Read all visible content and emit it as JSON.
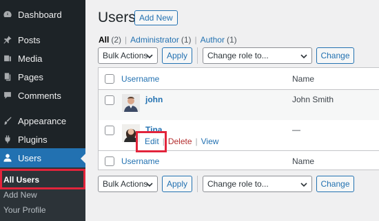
{
  "sidebar": {
    "items": [
      {
        "label": "Dashboard",
        "icon": "dashboard-icon"
      },
      {
        "label": "Posts",
        "icon": "pin-icon"
      },
      {
        "label": "Media",
        "icon": "media-icon"
      },
      {
        "label": "Pages",
        "icon": "pages-icon"
      },
      {
        "label": "Comments",
        "icon": "comment-icon"
      },
      {
        "label": "Appearance",
        "icon": "brush-icon"
      },
      {
        "label": "Plugins",
        "icon": "plugin-icon"
      },
      {
        "label": "Users",
        "icon": "user-icon"
      }
    ],
    "submenu": [
      {
        "label": "All Users"
      },
      {
        "label": "Add New"
      },
      {
        "label": "Your Profile"
      }
    ]
  },
  "main": {
    "title": "Users",
    "add_new": "Add New",
    "views": [
      {
        "label": "All",
        "count": "(2)"
      },
      {
        "label": "Administrator",
        "count": "(1)"
      },
      {
        "label": "Author",
        "count": "(1)"
      }
    ],
    "views_sep": "|",
    "top_controls": {
      "bulk_actions": "Bulk Actions",
      "apply": "Apply",
      "change_role": "Change role to...",
      "change": "Change"
    },
    "bottom_controls": {
      "bulk_actions": "Bulk Actions",
      "apply": "Apply",
      "change_role": "Change role to...",
      "change": "Change"
    },
    "table": {
      "columns": [
        "Username",
        "Name"
      ],
      "rows": [
        {
          "username": "john",
          "name": "John Smith"
        },
        {
          "username": "Tina",
          "name": "—"
        }
      ],
      "row_actions": {
        "edit": "Edit",
        "delete": "Delete",
        "view": "View",
        "sep": "|"
      }
    }
  },
  "colors": {
    "sidebar_bg": "#1d2327",
    "accent": "#2271b1",
    "highlight": "#e2243b",
    "delete": "#b32d2e"
  }
}
